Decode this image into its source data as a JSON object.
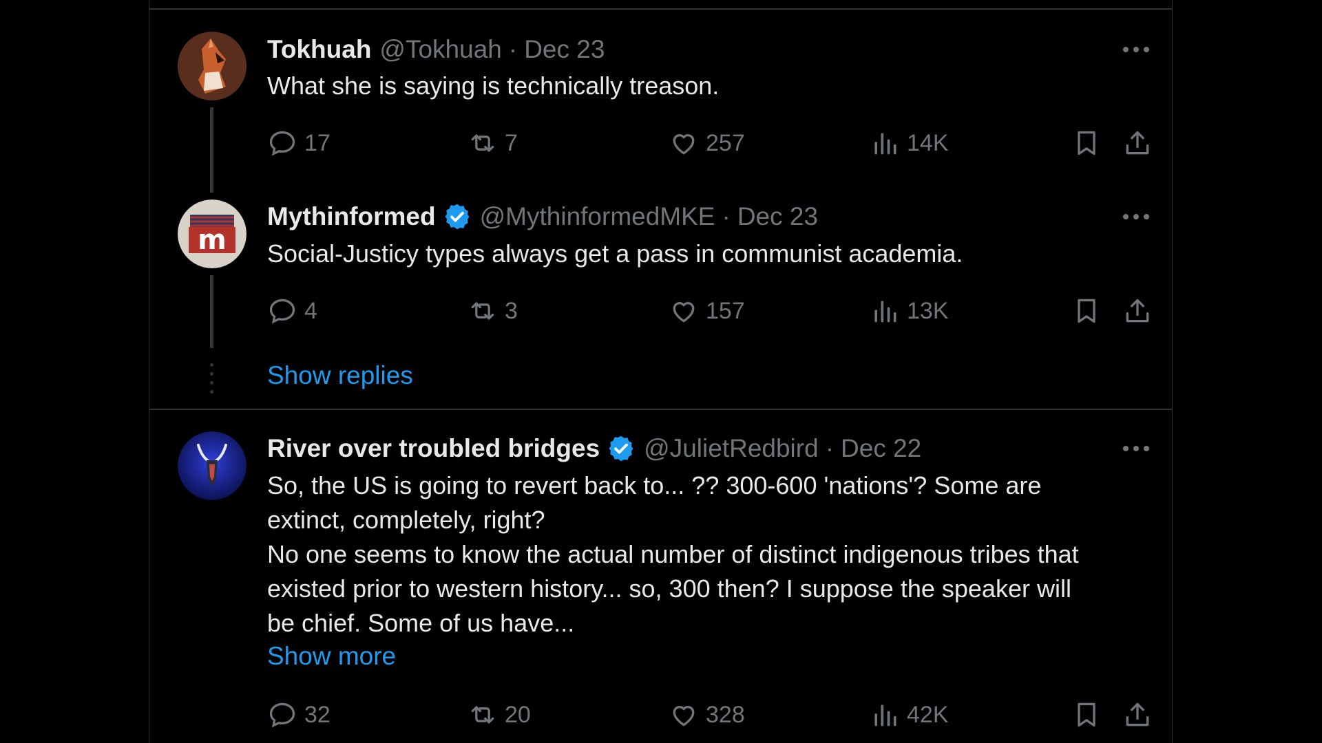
{
  "tweets": [
    {
      "name": "Tokhuah",
      "handle": "@Tokhuah",
      "separator": "·",
      "date": "Dec 23",
      "text": "What she is saying is technically treason.",
      "verified": false,
      "replies": "17",
      "reposts": "7",
      "likes": "257",
      "views": "14K"
    },
    {
      "name": "Mythinformed",
      "handle": "@MythinformedMKE",
      "separator": "·",
      "date": "Dec 23",
      "text": "Social-Justicy types always get a pass in communist academia.",
      "verified": true,
      "replies": "4",
      "reposts": "3",
      "likes": "157",
      "views": "13K"
    },
    {
      "name": "River over troubled bridges",
      "handle": "@JulietRedbird",
      "separator": "·",
      "date": "Dec 22",
      "text": "So, the US is going to revert back to... ?? 300-600 'nations'? Some are\nextinct, completely, right?\nNo one seems to know the actual number of distinct indigenous tribes that\nexisted prior to western history... so, 300 then? I suppose the speaker will\nbe chief. Some of us have...",
      "verified": true,
      "replies": "32",
      "reposts": "20",
      "likes": "328",
      "views": "42K"
    }
  ],
  "show_replies": "Show replies",
  "show_more": "Show more",
  "colors": {
    "background": "#000000",
    "text": "#e7e9ea",
    "secondary": "#71767b",
    "accent": "#1d9bf0",
    "divider": "#2f3336"
  },
  "icons": [
    "more-icon",
    "reply-icon",
    "repost-icon",
    "like-icon",
    "views-icon",
    "bookmark-icon",
    "share-icon",
    "verified-badge-icon"
  ]
}
